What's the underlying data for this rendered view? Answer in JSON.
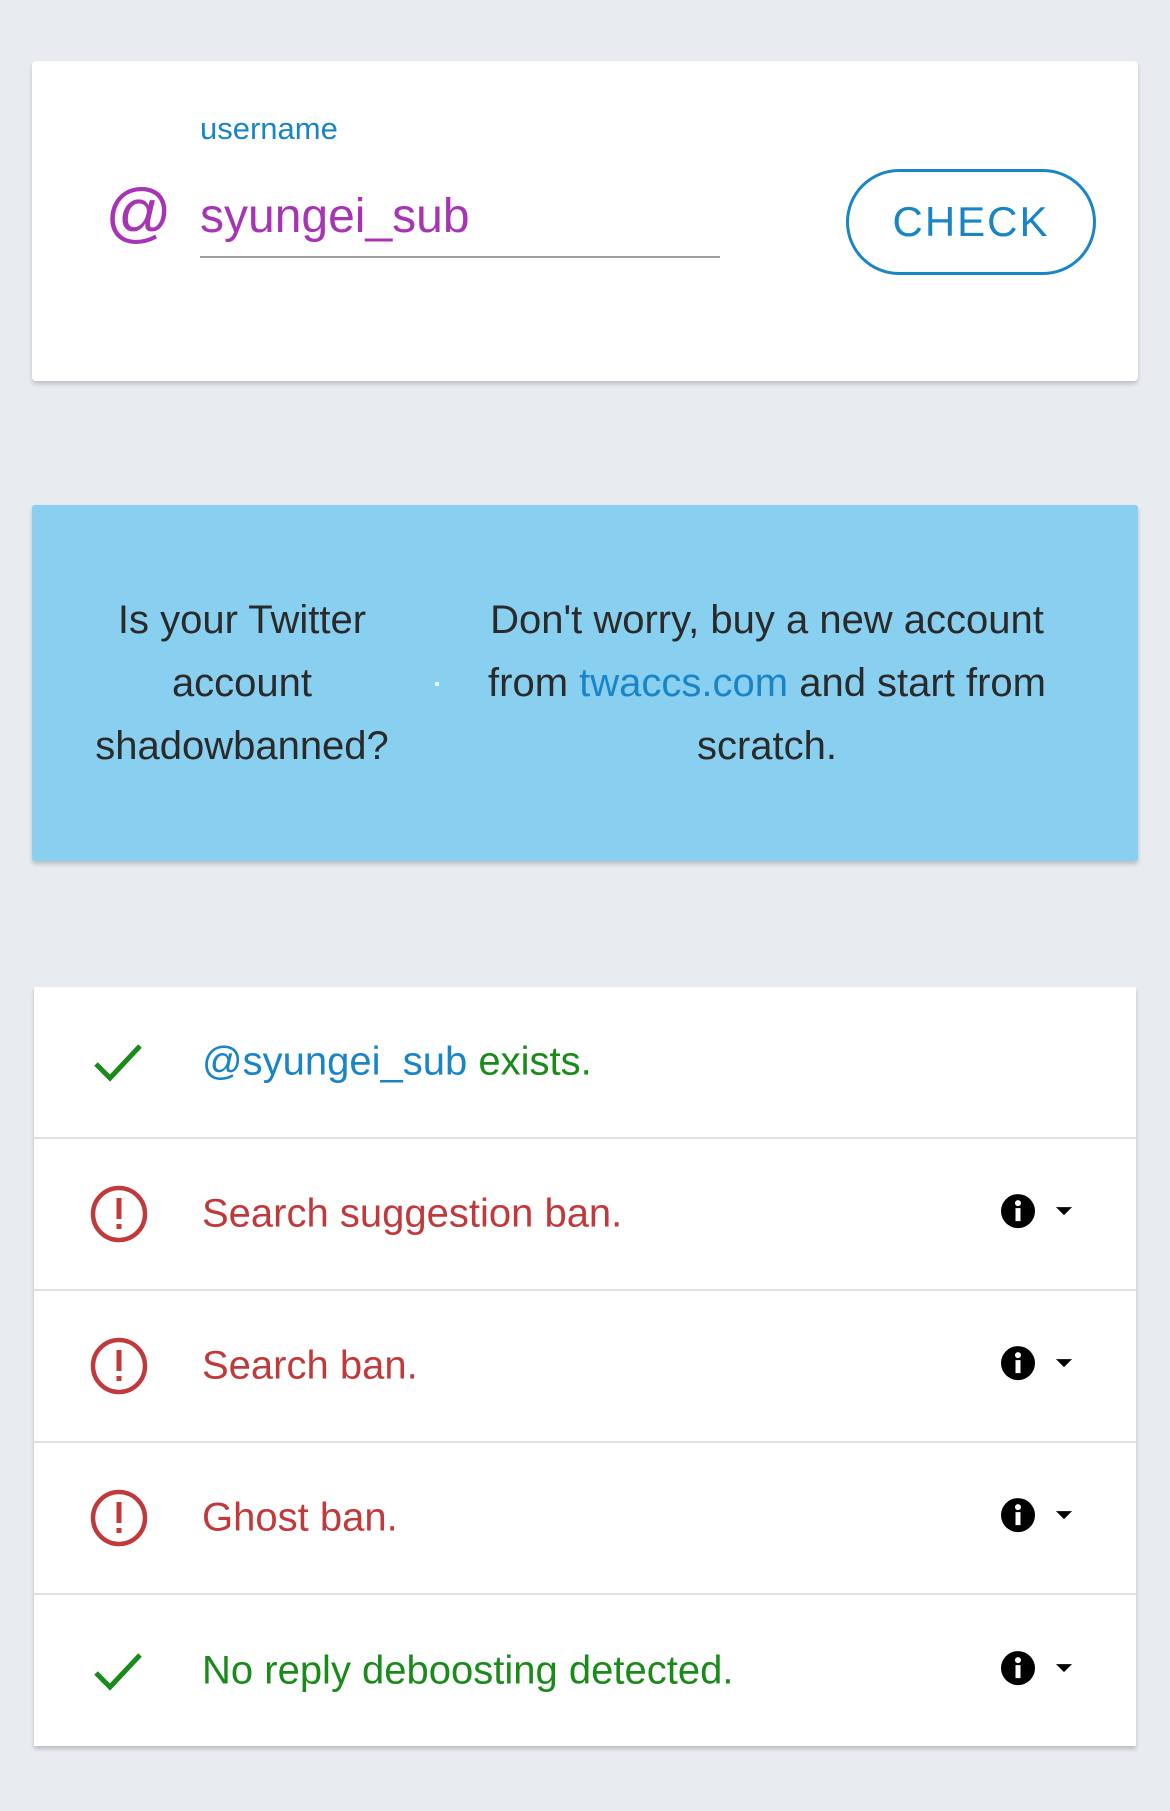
{
  "search": {
    "label": "username",
    "at_symbol": "@",
    "value": "syungei_sub",
    "button_label": "CHECK"
  },
  "banner": {
    "left_text": "Is your Twitter account shadowbanned?",
    "right_before": "Don't worry, buy a new account from ",
    "link_text": "twaccs.com",
    "right_after": " and start from scratch."
  },
  "results": [
    {
      "status": "ok",
      "icon": "checkmark-icon",
      "prefix": "@syungei_sub",
      "text": " exists.",
      "has_info": false
    },
    {
      "status": "ban",
      "icon": "alert-circle-icon",
      "prefix": "",
      "text": "Search suggestion ban.",
      "has_info": true
    },
    {
      "status": "ban",
      "icon": "alert-circle-icon",
      "prefix": "",
      "text": "Search ban.",
      "has_info": true
    },
    {
      "status": "ban",
      "icon": "alert-circle-icon",
      "prefix": "",
      "text": "Ghost ban.",
      "has_info": true
    },
    {
      "status": "ok",
      "icon": "checkmark-icon",
      "prefix": "",
      "text": "No reply deboosting detected.",
      "has_info": true
    }
  ],
  "colors": {
    "accent": "#1a85c6",
    "username": "#a634b5",
    "ok": "#1a8a1a",
    "ban": "#c0393b",
    "banner_bg": "#89cff0",
    "page_bg": "#e8ecf0"
  }
}
